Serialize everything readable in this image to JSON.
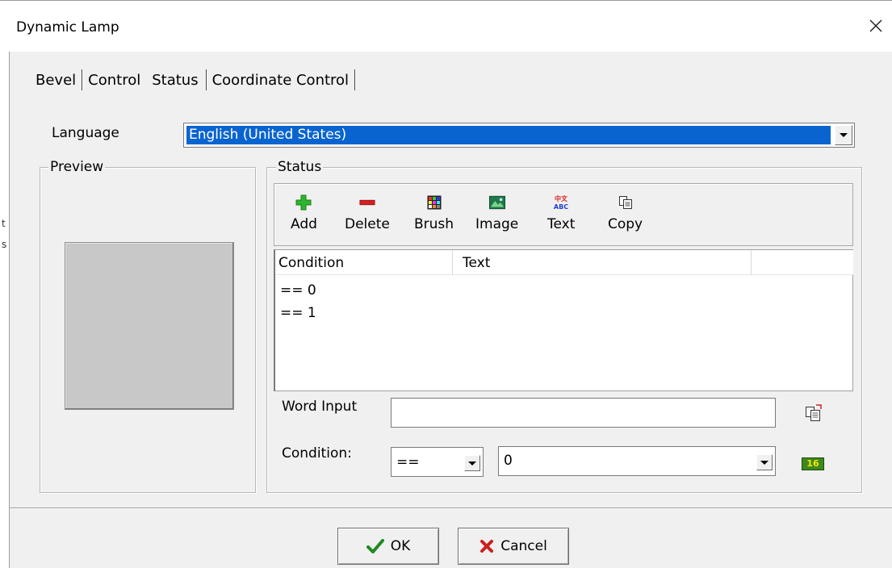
{
  "window": {
    "title": "Dynamic Lamp",
    "close_icon": "close-icon"
  },
  "edge_text": [
    "t",
    "s"
  ],
  "tabs": [
    {
      "label": "Bevel",
      "active": false
    },
    {
      "label": "Control",
      "active": false
    },
    {
      "label": "Status",
      "active": true
    },
    {
      "label": "Coordinate Control",
      "active": false
    }
  ],
  "language": {
    "label": "Language",
    "selected": "English (United States)"
  },
  "preview": {
    "title": "Preview",
    "swatch_color": "#c8c8c8"
  },
  "status": {
    "title": "Status",
    "toolbar": [
      {
        "name": "add",
        "label": "Add",
        "icon": "plus-icon"
      },
      {
        "name": "delete",
        "label": "Delete",
        "icon": "minus-icon"
      },
      {
        "name": "brush",
        "label": "Brush",
        "icon": "brush-palette-icon"
      },
      {
        "name": "image",
        "label": "Image",
        "icon": "image-icon"
      },
      {
        "name": "text",
        "label": "Text",
        "icon": "text-abc-icon"
      },
      {
        "name": "copy",
        "label": "Copy",
        "icon": "copy-icon"
      }
    ],
    "list": {
      "columns": [
        "Condition",
        "Text"
      ],
      "rows": [
        {
          "condition": "== 0",
          "text": ""
        },
        {
          "condition": "== 1",
          "text": ""
        }
      ]
    },
    "word_input": {
      "label": "Word Input",
      "value": ""
    },
    "condition": {
      "label": "Condition:",
      "operator": "==",
      "value": "0",
      "hex_badge": "16"
    }
  },
  "buttons": {
    "ok": "OK",
    "cancel": "Cancel"
  },
  "colors": {
    "selection": "#0a64d0",
    "add_green": "#2db52d",
    "delete_red": "#d42020",
    "badge_green": "#3c8a1e"
  }
}
